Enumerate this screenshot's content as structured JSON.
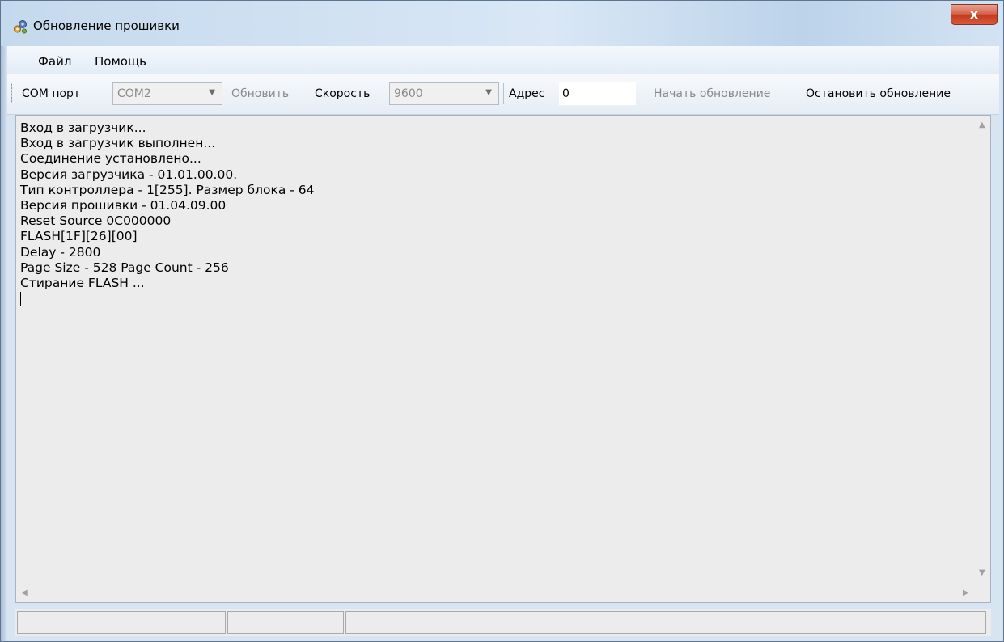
{
  "window": {
    "title": "Обновление прошивки",
    "close_symbol": "x",
    "icon": "gear-cluster-icon"
  },
  "menu": [
    {
      "label": "Файл"
    },
    {
      "label": "Помощь"
    }
  ],
  "toolbar": {
    "com_label": "COM порт",
    "com_value": "COM2",
    "refresh_label": "Обновить",
    "speed_label": "Скорость",
    "speed_value": "9600",
    "address_label": "Адрес",
    "address_value": "0",
    "start_label": "Начать обновление",
    "stop_label": "Остановить обновление"
  },
  "log": [
    "Вход в загрузчик...",
    "Вход в загрузчик выполнен...",
    "Соединение установлено...",
    "Версия загрузчика - 01.01.00.00.",
    "Тип контроллера - 1[255]. Размер блока - 64",
    "Версия прошивки - 01.04.09.00",
    "Reset Source 0C000000",
    "FLASH[1F][26][00]",
    "Delay - 2800",
    "Page Size - 528 Page Count - 256",
    "Стирание FLASH ..."
  ],
  "icons": {
    "dropdown": "chevron-down-icon",
    "scroll_up": "scroll-up-icon",
    "scroll_down": "scroll-down-icon",
    "scroll_left": "scroll-left-icon",
    "scroll_right": "scroll-right-icon"
  },
  "colors": {
    "window_frame": "#d7e4f2",
    "close_button": "#c43c1f",
    "log_background": "#ececec",
    "disabled_text": "#8a8a8a"
  }
}
